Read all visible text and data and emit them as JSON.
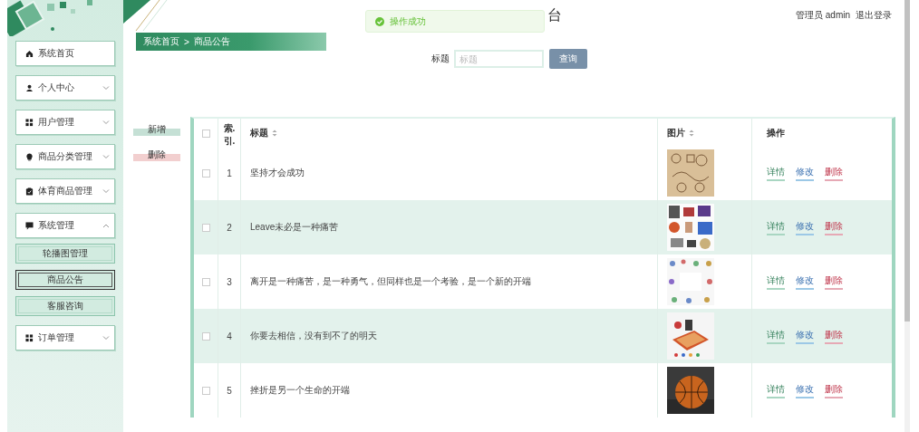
{
  "sidebar": {
    "items": [
      {
        "label": "系统首页",
        "kind": "link"
      },
      {
        "label": "个人中心",
        "kind": "menu",
        "expanded": false
      },
      {
        "label": "用户管理",
        "kind": "menu",
        "expanded": false
      },
      {
        "label": "商品分类管理",
        "kind": "menu",
        "expanded": false
      },
      {
        "label": "体育商品管理",
        "kind": "menu",
        "expanded": false
      },
      {
        "label": "系统管理",
        "kind": "menu",
        "expanded": true,
        "children": [
          {
            "label": "轮播图管理",
            "selected": false
          },
          {
            "label": "商品公告",
            "selected": true
          },
          {
            "label": "客服咨询",
            "selected": false
          }
        ]
      },
      {
        "label": "订单管理",
        "kind": "menu",
        "expanded": false
      }
    ]
  },
  "header": {
    "title": "台",
    "user": "管理员 admin",
    "logout": "退出登录"
  },
  "toast": {
    "message": "操作成功",
    "kind": "success"
  },
  "breadcrumb": {
    "items": [
      "系统首页",
      "商品公告"
    ],
    "separator": ">"
  },
  "search": {
    "label": "标题",
    "placeholder": "标题",
    "button": "查询"
  },
  "actions": [
    {
      "label": "新增",
      "kind": "add"
    },
    {
      "label": "删除",
      "kind": "delete"
    }
  ],
  "table": {
    "columns": [
      {
        "kind": "checkbox",
        "checked": false
      },
      {
        "kind": "text",
        "label": "索.引.",
        "sortable": false
      },
      {
        "kind": "text",
        "label": "标题",
        "sortable": true
      },
      {
        "kind": "text",
        "label": "图片",
        "sortable": true
      },
      {
        "kind": "text",
        "label": "操作",
        "sortable": false
      }
    ],
    "rows": [
      {
        "checked": false,
        "index": "1",
        "title": "坚持才会成功",
        "actions": [
          {
            "label": "详情",
            "kind": "view"
          },
          {
            "label": "修改",
            "kind": "edit"
          },
          {
            "label": "删除",
            "kind": "delete"
          }
        ]
      },
      {
        "checked": false,
        "index": "2",
        "title": "Leave未必是一种痛苦",
        "actions": [
          {
            "label": "详情",
            "kind": "view"
          },
          {
            "label": "修改",
            "kind": "edit"
          },
          {
            "label": "删除",
            "kind": "delete"
          }
        ]
      },
      {
        "checked": false,
        "index": "3",
        "title": "离开是一种痛苦，是一种勇气，但同样也是一个考验，是一个新的开端",
        "actions": [
          {
            "label": "详情",
            "kind": "view"
          },
          {
            "label": "修改",
            "kind": "edit"
          },
          {
            "label": "删除",
            "kind": "delete"
          }
        ]
      },
      {
        "checked": false,
        "index": "4",
        "title": "你要去相信，没有到不了的明天",
        "actions": [
          {
            "label": "详情",
            "kind": "view"
          },
          {
            "label": "修改",
            "kind": "edit"
          },
          {
            "label": "删除",
            "kind": "delete"
          }
        ]
      },
      {
        "checked": false,
        "index": "5",
        "title": "挫折是另一个生命的开端",
        "actions": [
          {
            "label": "详情",
            "kind": "view"
          },
          {
            "label": "修改",
            "kind": "edit"
          },
          {
            "label": "删除",
            "kind": "delete"
          }
        ]
      }
    ]
  }
}
